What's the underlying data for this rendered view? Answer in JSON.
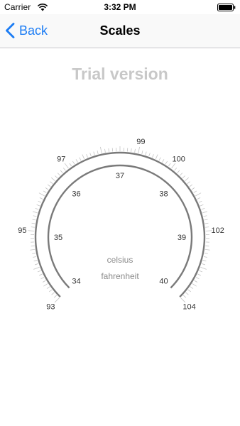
{
  "status_bar": {
    "carrier": "Carrier",
    "time": "3:32 PM"
  },
  "nav": {
    "back_label": "Back",
    "title": "Scales",
    "accent_color": "#1b7cf4"
  },
  "trial_text": "Trial version",
  "gauge": {
    "outer_scale": {
      "unit": "fahrenheit",
      "min": 93,
      "max": 104,
      "labels": [
        "93",
        "95",
        "97",
        "99",
        "100",
        "102",
        "104"
      ],
      "label_values": [
        93,
        95,
        97,
        99,
        100,
        102,
        104
      ]
    },
    "inner_scale": {
      "unit": "celsius",
      "min": 34,
      "max": 40,
      "labels": [
        "34",
        "35",
        "36",
        "37",
        "38",
        "39",
        "40"
      ],
      "label_values": [
        34,
        35,
        36,
        37,
        38,
        39,
        40
      ]
    },
    "celsius_label": "celsius",
    "fahrenheit_label": "fahrenheit"
  }
}
